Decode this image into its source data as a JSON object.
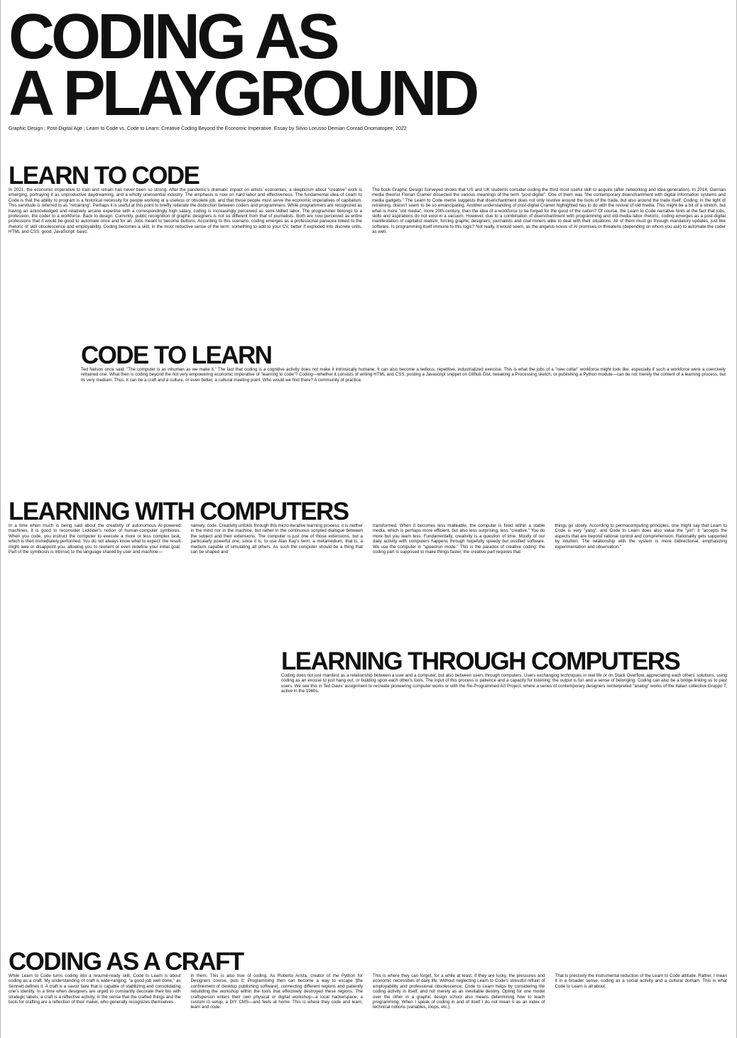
{
  "page": {
    "title_lines": [
      "CODING AS",
      "A PLAYGROUND"
    ],
    "subtitle": "Graphic Design ; Post-Digital Age ; Learn to Code vs. Code to Learn: Creative Coding Beyond the Economic Imperative. Essay by Silvio Lorusso Demian Conrad Onomatopee, 2022"
  },
  "sections": {
    "learn_to_code": {
      "heading": "LEARN TO CODE",
      "col1": "In 2021, the economic imperative to train and retrain has never been so strong. After the pandemic's dramatic impact on artists' economies, a skepticism about \"creative\" work is emerging, portraying it as unproductive daydreaming, and a wholly unessential industry. The emphasis is now on hard labor and effectiveness. The fundamental idea of Learn to Code is that the ability to program is a historical necessity for people working at a useless or obsolete job, and that these people must serve the economic imperatives of capitalism. This servitude is referred to as \"retraining\". Perhaps it is useful at this point to briefly reiterate the distinction between coders and programmers. While programmers are recognized as having an acknowledged and relatively arcane expertise with a correspondingly high salary, coding is increasingly perceived as semi-skilled labor. The programmer belongs to a profession, the coder to a workforce. Back to design. Currently, public recognition of graphic designers is not so different from that of journalists. Both are now perceived as entire professions that it would be good to automate once and for all. Jobs meant to become buttons. According to this scenario, coding emerges as a professional panacea linked to the rhetoric of skill obsolescence and employability. Coding becomes a skill, in the most reductive sense of the term: something to add to your CV, better if exploded into discrete units. HTML and CSS: good, JavaScript: basic.",
      "col2": "The book Graphic Design Surveyed shows that US and UK students consider coding the third most useful skill to acquire (after networking and idea generation). In 2014, German media theorist Florian Cramer dissected the various meanings of the term \"post-digital\". One of them was \"the contemporary disenchantment with digital information systems and media gadgets.\" The Learn to Code meme suggests that disenchantment does not only revolve around the tools of the trade, but also around the trade itself. Coding, in the light of retraining, doesn't seem to be so emancipating. Another understanding of post-digital Cramer highlighted has to do with the revival of old media. This might be a bit of a stretch, but what is more \"old media\", more 20th-century, than the idea of a workforce to be forged for the good of the nation? Of course, the Learn to Code narrative hints at the fact that jobs, skills and aspirations do not exist in a vacuum. However, due to a combination of disenchantment with programming and old-media labor rhetoric, coding emerges as a post-digital manifestation of capitalist realism, forcing graphic designers, journalists and coal miners alike to deal with their situations. All of them must go through mandatory updates, just like software. Is programming itself immune to this logic? Not really, it would seem, as the angelus novus of AI promises or threatens (depending on whom you ask) to automate the coder as well."
    },
    "code_to_learn": {
      "heading": "CODE TO LEARN",
      "text": "Ted Nelson once said: \"The computer is as inhuman as we make it.\" The fact that coding is a cognitive activity does not make it intrinsically humane. It can also become a tedious, repetitive, industrialized exercise. This is what the jobs of a \"new collar\" workforce might look like, especially if such a workforce were a coercively retrained one. What then is coding beyond the not very empowering economic imperative of \"learning to code\"? Coding—whether it consists of writing HTML and CSS, posting a Javascript snippet on Github Gist, tweaking a Processing sketch, or publishing a Python module—can be not merely the content of a learning process, but its very medium. Thus, it can be a craft and a culture, or even better, a cultural meeting point. Who would we find there? A community of practice."
    },
    "learning_with_computers": {
      "heading": "LEARNING WITH COMPUTERS",
      "col1": "In a time when much is being said about the creativity of autonomous AI-powered machines, it is good to reconsider Licklider's notion of human-computer symbiosis. When you code, you instruct the computer to execute a more or less complex task, which is then immediately performed. You do not always know what to expect: the result might awe or disappoint you, allowing you to reorient or even redefine your initial goal. Part of the symbiosis is intrinsic to the language shared by user and machine—",
      "col2": "namely, code. Creativity unfolds through this micro-iterative learning process: it is neither in the mind nor in the machine, but rather in the continuous scripted dialogue between the subject and their extensions. The computer is just one of those extensions, but a particularly powerful one, since it is, to use Alan Kay's term, a metamedium, that is, a medium capable of simulating all others. As such the computer should be a thing that can be shaped and",
      "col3": "transformed. When it becomes less malleable, the computer is fixed within a stable media, which is perhaps more efficient, but also less surprising, less \"creative.\" You do more but you learn less. Fundamentally, creativity is a question of time. Mostly of our daily activity with computers happens through hopefully speedy but ossified software. We use the computer in \"speedrun mode.\" This is the paradox of creative coding: the coding part is supposed to make things faster, the creative part requires that",
      "col4": "things go slowly. According to permacomputing principles, one might say that Learn to Code is very \"yang\", and Code to Learn does also value the \"yin\": it \"accepts the aspects that are beyond rational control and comprehension. Rationality gets supported by intuition. The relationship with the system is more bidirectional, emphasizing experimentation and observation.\""
    },
    "learning_through_computers": {
      "heading": "LEARNING THROUGH COMPUTERS",
      "text": "Coding does not just manifest as a relationship between a user and a computer, but also between users through computers. Users exchanging techniques in real life or on Stack Overflow, appreciating each others' solutions, using coding as an excuse to just hang out, or building upon each other's tools. The input of this process is patience and a capacity for listening; the output is fun and a sense of belonging. Coding can also be a bridge linking us to past users. We see this in Ted Davis' assignment to recreate pioneering computer works or with the Re-Programmed Art Project, where a series of contemporary designers reinterpreted \"analog\" works of the Italian collective Gruppo T, active in the 1960s."
    },
    "coding_as_a_craft": {
      "heading": "CODING AS A CRAFT",
      "col1": "While Learn to Code turns coding into a resumé-ready skill, Code to Learn is about coding as a craft. My understanding of craft is wide-ranging: \"a good job well done,\" as Sennett defines it. A craft is a savoir faire that is capable of stabilizing and consolidating one's identity. In a time when designers are urged to constantly decorate their bio with strategic labels, a craft is a reflective activity, in the sense that the crafted things and the tools for crafting are a reflection of their maker, who generally recognizes themselves",
      "col2": "in them. This is also true of coding. As Roberto Arista, creator of the Python for Designers course, puts it: Programming then can become a way to escape [the confinement of desktop publishing software], connecting different regions and patiently rebuilding the workshop within the tools that effectively destroyed these regions. The craftsperson enters their own physical or digital workshop—a local hackerspace, a custom i3 setup, a DIY CMS—and feels at home. This is where they code and learn, learn and code.",
      "col3": "This is where they can forget, for a while at least, if they are lucky, the pressures and economic necessities of daily life. Without neglecting Learn to Code's stressful refrain of employability and professional obsolescence, Code to Learn helps by considering the coding activity in itself, and not merely as an inevitable destiny. Opting for one model over the other in a graphic design school also means determining how to teach programming. When I speak of coding in and of itself I do not mean it as an index of technical notions (variables, loops, etc.).",
      "col4": "That is precisely the instrumental reduction of the Learn to Code attitude. Rather, I mean it in a broader sense, coding as a social activity and a cultural domain. This is what Code to Learn is all about."
    }
  }
}
